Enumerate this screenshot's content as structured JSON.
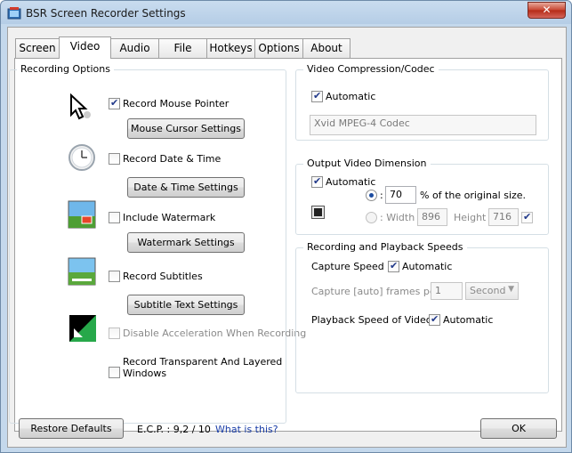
{
  "window": {
    "title": "BSR Screen Recorder Settings",
    "close_label": "✕"
  },
  "tabs": [
    {
      "label": "Screen"
    },
    {
      "label": "Video"
    },
    {
      "label": "Audio"
    },
    {
      "label": "File"
    },
    {
      "label": "Hotkeys"
    },
    {
      "label": "Options"
    },
    {
      "label": "About"
    }
  ],
  "recording_options": {
    "title": "Recording Options",
    "mouse_pointer": {
      "label": "Record Mouse Pointer",
      "checked": true,
      "button": "Mouse Cursor Settings"
    },
    "date_time": {
      "label": "Record Date & Time",
      "checked": false,
      "button": "Date & Time Settings"
    },
    "watermark": {
      "label": "Include Watermark",
      "checked": false,
      "button": "Watermark Settings"
    },
    "subtitles": {
      "label": "Record Subtitles",
      "checked": false,
      "button": "Subtitle Text Settings"
    },
    "acceleration": {
      "label": "Disable Acceleration When Recording",
      "checked": false,
      "disabled": true
    },
    "transparent": {
      "label_line1": "Record Transparent And Layered",
      "label_line2": "Windows",
      "checked": false
    }
  },
  "compression": {
    "title": "Video Compression/Codec",
    "automatic_label": "Automatic",
    "automatic_checked": true,
    "codec_value": "Xvid MPEG-4 Codec"
  },
  "dimension": {
    "title": "Output Video Dimension",
    "automatic_label": "Automatic",
    "automatic_checked": true,
    "percent_radio_label": ":",
    "percent_value": "70",
    "percent_suffix": "% of the original size.",
    "width_label": ": Width :",
    "width_value": "896",
    "height_label": "Height :",
    "height_value": "716"
  },
  "speeds": {
    "title": "Recording and Playback Speeds",
    "capture_label": "Capture Speed :",
    "capture_auto_label": "Automatic",
    "capture_auto_checked": true,
    "capture_line_label": "Capture  [auto]  frames per",
    "frames_value": "1",
    "unit_value": "Second",
    "playback_label": "Playback Speed of Video :",
    "playback_auto_label": "Automatic",
    "playback_auto_checked": true
  },
  "footer": {
    "restore_button": "Restore Defaults",
    "ecp_label": "E.C.P. : 9,2 / 10",
    "link": "What is this?",
    "ok_button": "OK"
  },
  "colors": {
    "link": "#1a3ea8",
    "titlebar": "#b5cde6",
    "close": "#c7432f"
  }
}
